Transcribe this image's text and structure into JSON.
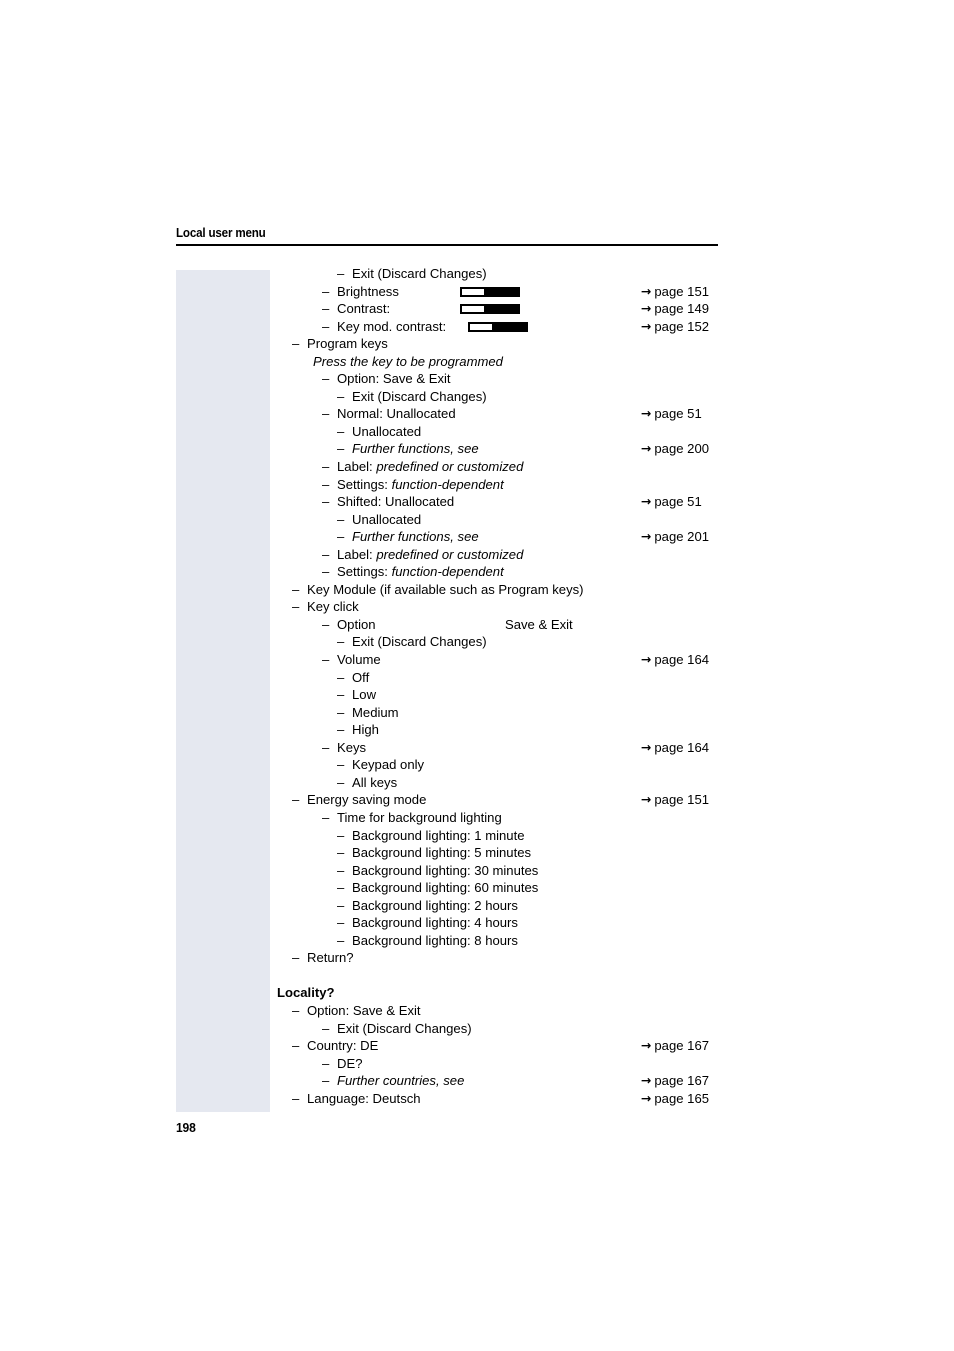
{
  "document": {
    "running_head": "Local user menu",
    "folio": "198"
  },
  "icons": {
    "page_arrow": "→",
    "dash": "–"
  },
  "outline": [
    {
      "level": 3,
      "text": "Exit (Discard Changes)"
    },
    {
      "level": 2,
      "text": "Brightness",
      "slider": "a",
      "pageref": "page 151"
    },
    {
      "level": 2,
      "text": "Contrast:",
      "slider": "b",
      "pageref": "page 149"
    },
    {
      "level": 2,
      "text": "Key mod. contrast:",
      "slider": "c",
      "pageref": "page 152"
    },
    {
      "level": 1,
      "text": "Program keys"
    },
    {
      "level": 0,
      "note": true,
      "text": "Press the key to be programmed"
    },
    {
      "level": 2,
      "text": "Option: Save & Exit"
    },
    {
      "level": 3,
      "text": "Exit (Discard Changes)"
    },
    {
      "level": 2,
      "text": "Normal: Unallocated",
      "pageref": "page 51"
    },
    {
      "level": 3,
      "text": "Unallocated"
    },
    {
      "level": 3,
      "text": "Further functions, see",
      "italic": true,
      "pageref": "page 200"
    },
    {
      "level": 2,
      "text_plain": "Label: ",
      "text_italic": "predefined or customized"
    },
    {
      "level": 2,
      "text_plain": "Settings: ",
      "text_italic": "function-dependent"
    },
    {
      "level": 2,
      "text": "Shifted: Unallocated",
      "pageref": "page 51"
    },
    {
      "level": 3,
      "text": "Unallocated"
    },
    {
      "level": 3,
      "text": "Further functions, see",
      "italic": true,
      "pageref": "page 201"
    },
    {
      "level": 2,
      "text_plain": "Label: ",
      "text_italic": "predefined or customized"
    },
    {
      "level": 2,
      "text_plain": "Settings: ",
      "text_italic": "function-dependent"
    },
    {
      "level": 1,
      "text": "Key Module (if available such as Program keys)"
    },
    {
      "level": 1,
      "text": "Key click"
    },
    {
      "level": 2,
      "text": "Option",
      "col2": "Save & Exit"
    },
    {
      "level": 3,
      "text": "Exit (Discard Changes)"
    },
    {
      "level": 2,
      "text": "Volume",
      "pageref": "page 164"
    },
    {
      "level": 3,
      "text": "Off"
    },
    {
      "level": 3,
      "text": "Low"
    },
    {
      "level": 3,
      "text": "Medium"
    },
    {
      "level": 3,
      "text": "High"
    },
    {
      "level": 2,
      "text": "Keys",
      "pageref": "page 164"
    },
    {
      "level": 3,
      "text": "Keypad only"
    },
    {
      "level": 3,
      "text": "All keys"
    },
    {
      "level": 1,
      "text": "Energy saving mode",
      "pageref": "page 151"
    },
    {
      "level": 2,
      "text": "Time for background lighting"
    },
    {
      "level": 3,
      "text": "Background lighting: 1 minute"
    },
    {
      "level": 3,
      "text": "Background lighting: 5 minutes"
    },
    {
      "level": 3,
      "text": "Background lighting: 30 minutes"
    },
    {
      "level": 3,
      "text": "Background lighting: 60 minutes"
    },
    {
      "level": 3,
      "text": "Background lighting: 2 hours"
    },
    {
      "level": 3,
      "text": "Background lighting: 4 hours"
    },
    {
      "level": 3,
      "text": "Background lighting: 8 hours"
    },
    {
      "level": 1,
      "text": "Return?"
    },
    {
      "spacer": true
    },
    {
      "level": 0,
      "heading": true,
      "text": "Locality?"
    },
    {
      "level": 1,
      "text": "Option: Save & Exit"
    },
    {
      "level": 2,
      "text": "Exit (Discard Changes)"
    },
    {
      "level": 1,
      "text": "Country: DE",
      "pageref": "page 167"
    },
    {
      "level": 2,
      "text": "DE?"
    },
    {
      "level": 2,
      "text": "Further countries, see",
      "italic": true,
      "pageref": "page 167"
    },
    {
      "level": 1,
      "text": "Language: Deutsch",
      "pageref": "page 165"
    }
  ]
}
